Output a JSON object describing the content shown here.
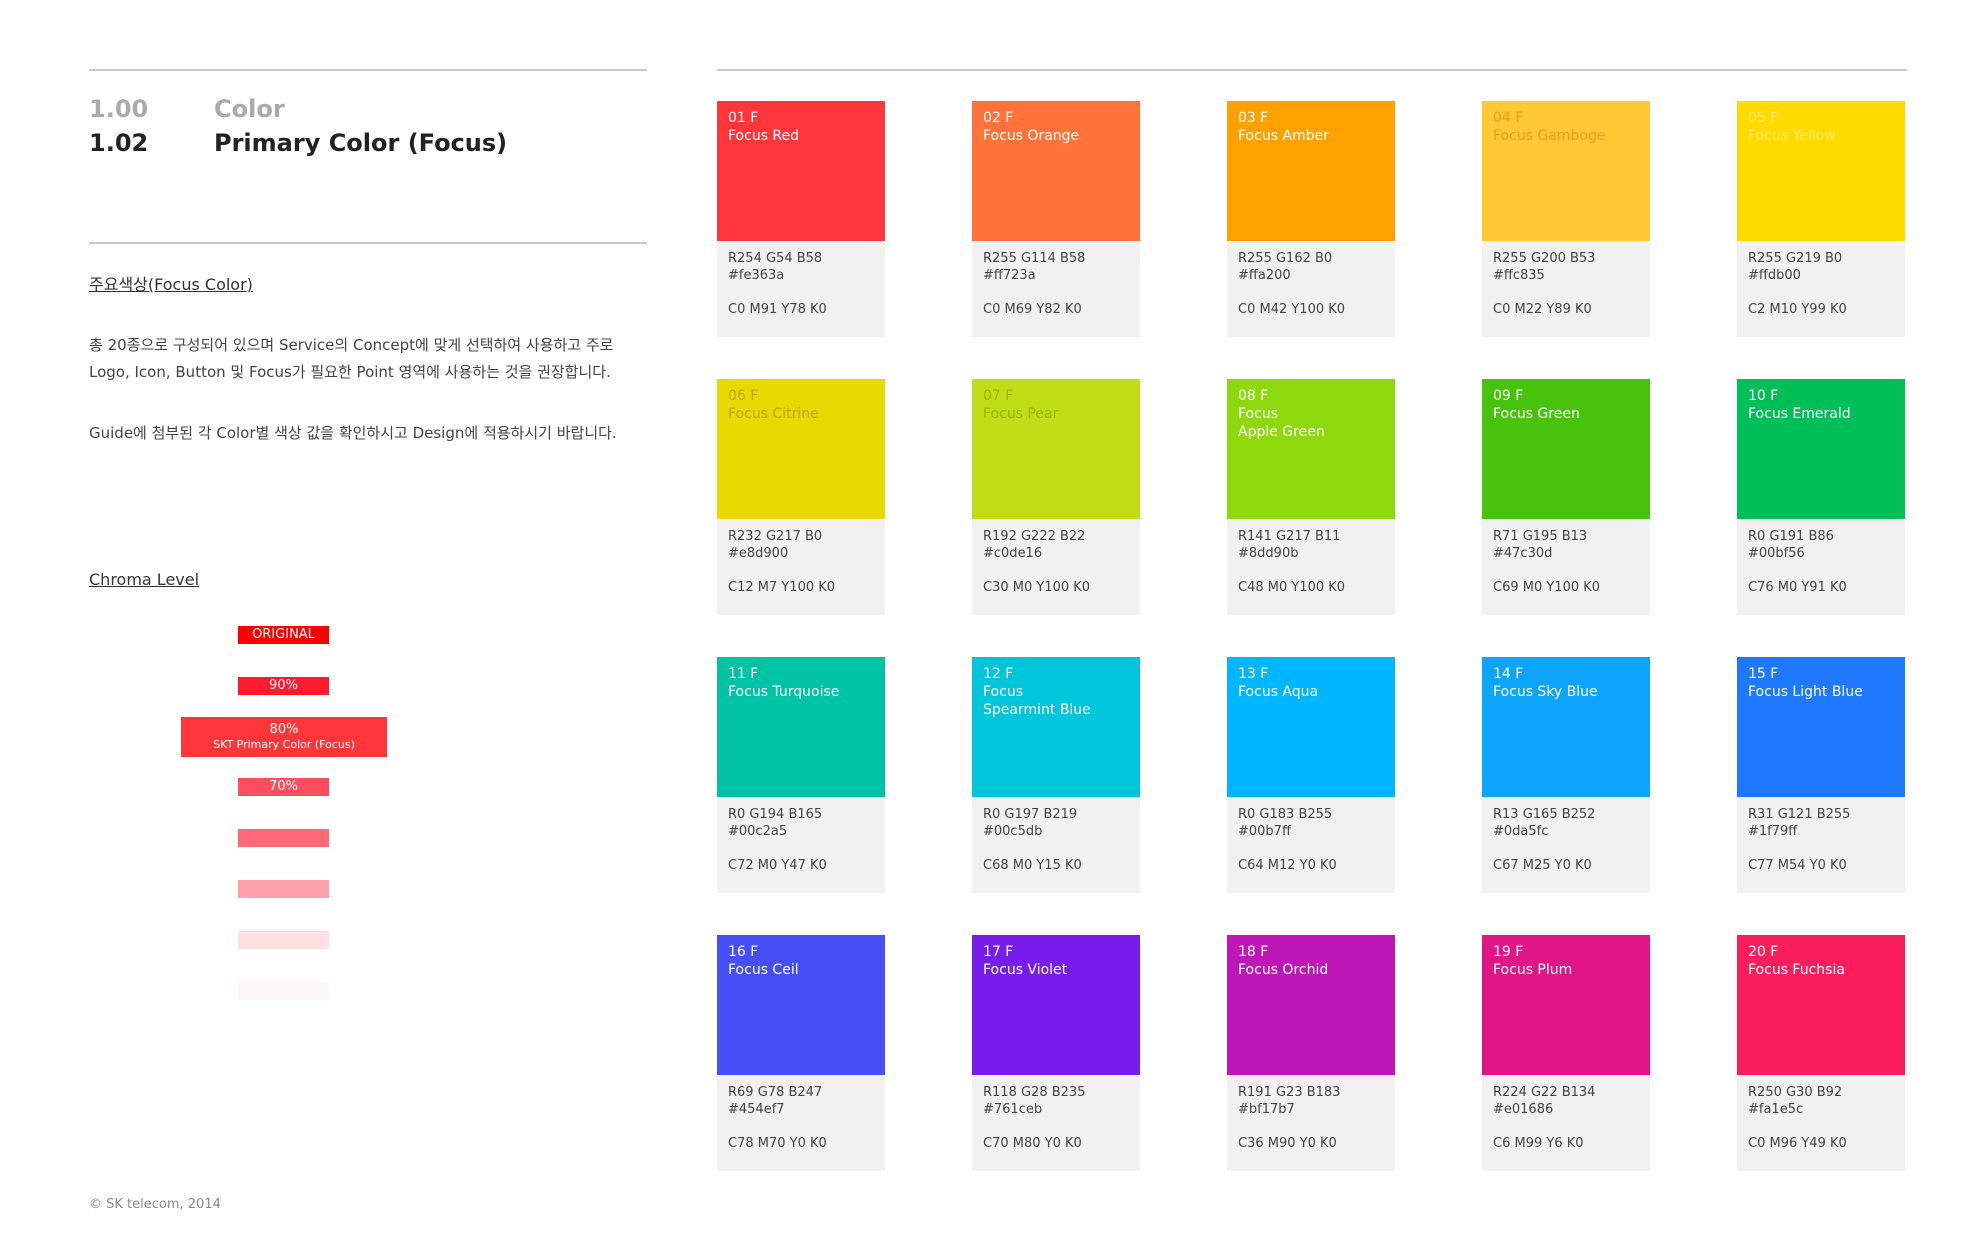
{
  "section": {
    "items": [
      {
        "number": "1.00",
        "title": "Color"
      },
      {
        "number": "1.02",
        "title": "Primary Color (Focus)"
      }
    ]
  },
  "focus_color": {
    "heading": "주요색상(Focus Color)",
    "paragraph_1": "총 20종으로 구성되어 있으며 Service의 Concept에 맞게 선택하여 사용하고 주로 Logo, Icon, Button 및 Focus가 필요한 Point 영역에 사용하는 것을 권장합니다.",
    "paragraph_2": "Guide에 첨부된 각 Color별 색상 값을 확인하시고 Design에 적용하시기 바랍니다."
  },
  "chroma": {
    "heading": "Chroma Level",
    "levels": [
      {
        "label": "ORIGINAL",
        "color": "#fe0000"
      },
      {
        "label": "90%",
        "color": "#fe1b2d"
      },
      {
        "label": "80%",
        "sublabel": "SKT Primary Color (Focus)",
        "color": "#fe363a"
      },
      {
        "label": "70%",
        "color": "#fe4d5e"
      },
      {
        "label": "",
        "color": "#fe6877"
      },
      {
        "label": "",
        "color": "#fea1ab"
      },
      {
        "label": "",
        "color": "#fee0e3"
      },
      {
        "label": "",
        "color": "#fff8f9"
      }
    ]
  },
  "swatches": [
    {
      "code": "01 F",
      "name": "Focus Red",
      "rgb": "R254  G54  B58",
      "hex": "#fe363a",
      "cmyk": "C0 M91 Y78 K0",
      "color": "#fe363a",
      "text_color": "#ffffff"
    },
    {
      "code": "02 F",
      "name": "Focus Orange",
      "rgb": "R255  G114  B58",
      "hex": "#ff723a",
      "cmyk": "C0 M69 Y82 K0",
      "color": "#ff723a",
      "text_color": "#ffffff"
    },
    {
      "code": "03 F",
      "name": "Focus Amber",
      "rgb": "R255  G162  B0",
      "hex": "#ffa200",
      "cmyk": "C0 M42 Y100 K0",
      "color": "#ffa200",
      "text_color": "#ffffff"
    },
    {
      "code": "04 F",
      "name": "Focus Gamboge",
      "rgb": "R255  G200 B53",
      "hex": "#ffc835",
      "cmyk": "C0 M22 Y89 K0",
      "color": "#ffc835",
      "text_color": "#f39a1e"
    },
    {
      "code": "05 F",
      "name": "Focus Yellow",
      "rgb": "R255  G219  B0",
      "hex": "#ffdb00",
      "cmyk": "C2 M10 Y99 K0",
      "color": "#ffdb00",
      "text_color": "#ffe966"
    },
    {
      "code": "06 F",
      "name": "Focus Citrine",
      "rgb": "R232  G217  B0",
      "hex": "#e8d900",
      "cmyk": "C12 M7 Y100 K0",
      "color": "#e8d900",
      "text_color": "#b9a700"
    },
    {
      "code": "07 F",
      "name": "Focus Pear",
      "rgb": "R192  G222  B22",
      "hex": "#c0de16",
      "cmyk": "C30 M0 Y100 K0",
      "color": "#c0de16",
      "text_color": "#94b600"
    },
    {
      "code": "08 F",
      "name": "Focus\nApple Green",
      "rgb": "R141  G217  B11",
      "hex": "#8dd90b",
      "cmyk": "C48  M0 Y100 K0",
      "color": "#8dd90b",
      "text_color": "#ffffff"
    },
    {
      "code": "09 F",
      "name": "Focus Green",
      "rgb": "R71  G195  B13",
      "hex": "#47c30d",
      "cmyk": "C69 M0 Y100 K0",
      "color": "#47c30d",
      "text_color": "#ffffff"
    },
    {
      "code": "10 F",
      "name": "Focus Emerald",
      "rgb": "R0  G191  B86",
      "hex": "#00bf56",
      "cmyk": "C76 M0 Y91 K0",
      "color": "#00bf56",
      "text_color": "#ffffff"
    },
    {
      "code": "11 F",
      "name": "Focus Turquoise",
      "rgb": "R0  G194  B165",
      "hex": "#00c2a5",
      "cmyk": "C72 M0 Y47 K0",
      "color": "#00c2a5",
      "text_color": "#ffffff"
    },
    {
      "code": "12 F",
      "name": "Focus\nSpearmint Blue",
      "rgb": "R0  G197  B219",
      "hex": "#00c5db",
      "cmyk": "C68 M0 Y15 K0",
      "color": "#00c5db",
      "text_color": "#ffffff"
    },
    {
      "code": "13 F",
      "name": "Focus Aqua",
      "rgb": "R0  G183  B255",
      "hex": "#00b7ff",
      "cmyk": "C64 M12 Y0 K0",
      "color": "#00b7ff",
      "text_color": "#ffffff"
    },
    {
      "code": "14 F",
      "name": "Focus Sky Blue",
      "rgb": "R13  G165  B252",
      "hex": "#0da5fc",
      "cmyk": "C67 M25 Y0 K0",
      "color": "#0da5fc",
      "text_color": "#ffffff"
    },
    {
      "code": "15 F",
      "name": "Focus Light Blue",
      "rgb": "R31  G121  B255",
      "hex": "#1f79ff",
      "cmyk": "C77 M54 Y0 K0",
      "color": "#1f79ff",
      "text_color": "#ffffff"
    },
    {
      "code": "16 F",
      "name": "Focus Ceil",
      "rgb": "R69  G78  B247",
      "hex": "#454ef7",
      "cmyk": "C78 M70 Y0 K0",
      "color": "#454ef7",
      "text_color": "#ffffff"
    },
    {
      "code": "17 F",
      "name": "Focus Violet",
      "rgb": "R118  G28  B235",
      "hex": "#761ceb",
      "cmyk": "C70 M80 Y0 K0",
      "color": "#761ceb",
      "text_color": "#ffffff"
    },
    {
      "code": "18 F",
      "name": "Focus Orchid",
      "rgb": "R191  G23  B183",
      "hex": "#bf17b7",
      "cmyk": "C36 M90 Y0 K0",
      "color": "#bf17b7",
      "text_color": "#ffffff"
    },
    {
      "code": "19 F",
      "name": "Focus Plum",
      "rgb": "R224  G22  B134",
      "hex": "#e01686",
      "cmyk": "C6 M99 Y6 K0",
      "color": "#e01686",
      "text_color": "#ffffff"
    },
    {
      "code": "20 F",
      "name": "Focus Fuchsia",
      "rgb": "R250  G30  B92",
      "hex": "#fa1e5c",
      "cmyk": "C0 M96 Y49 K0",
      "color": "#fa1e5c",
      "text_color": "#ffffff"
    }
  ],
  "footer": {
    "copyright": "© SK telecom, 2014"
  }
}
